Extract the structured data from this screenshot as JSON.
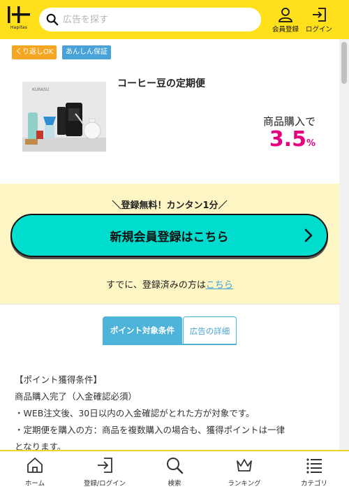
{
  "header": {
    "logo_text": "Hapitas",
    "search_placeholder": "広告を探す",
    "register_label": "会員登録",
    "login_label": "ログイン"
  },
  "badges": {
    "repeat": "くり返しOK",
    "assurance": "あんしん保証"
  },
  "product": {
    "image_brand": "KURASU",
    "title": "コーヒー豆の定期便",
    "rate_label": "商品購入で",
    "rate_value": "3.5",
    "rate_unit": "%"
  },
  "registration": {
    "tagline": "＼登録無料！カンタン1分／",
    "button_label": "新規会員登録はこちら",
    "login_prefix": "すでに、登録済みの方は",
    "login_link": "こちら"
  },
  "tabs": [
    {
      "label": "ポイント対象条件"
    },
    {
      "label": "広告の詳細"
    }
  ],
  "conditions": {
    "heading": "【ポイント獲得条件】",
    "line1": "商品購入完了（入金確認必須）",
    "line2": "・WEB注文後、30日以内の入金確認がとれた方が対象です。",
    "line3": "・定期便を購入の方：商品を複数購入の場合も、獲得ポイントは一律",
    "line4": "となります。"
  },
  "bottom_nav": [
    {
      "label": "ホーム",
      "icon": "home-icon"
    },
    {
      "label": "登録/ログイン",
      "icon": "login-icon"
    },
    {
      "label": "検索",
      "icon": "search-icon"
    },
    {
      "label": "ランキング",
      "icon": "crown-icon"
    },
    {
      "label": "カテゴリ",
      "icon": "list-icon"
    }
  ],
  "colors": {
    "header": "#ffe01b",
    "accent_pink": "#e6007e",
    "register_button": "#00dccd",
    "tab_blue": "#4db3d9",
    "badge_orange": "#f5a623",
    "badge_blue": "#4aa3d8",
    "registration_bg": "#fdf5c4"
  }
}
